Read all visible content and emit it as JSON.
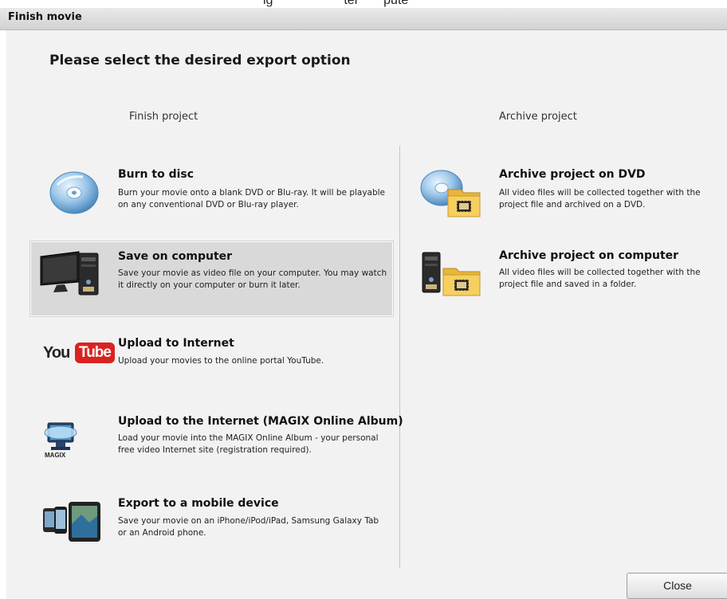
{
  "window": {
    "title": "Finish movie",
    "top_fragment": "ig                    ter       pute"
  },
  "heading": "Please select the desired export option",
  "columns": {
    "finish": "Finish project",
    "archive": "Archive project"
  },
  "finish_options": [
    {
      "title": "Burn to disc",
      "desc": "Burn your movie onto a blank DVD or Blu-ray. It will be playable on any conventional DVD or Blu-ray player.",
      "icon": "disc-icon"
    },
    {
      "title": "Save on computer",
      "desc": "Save your movie as video file on your computer. You may watch it directly on your computer or burn it later.",
      "icon": "computer-icon",
      "selected": true
    },
    {
      "title": "Upload to Internet",
      "desc": "Upload your movies to the online portal YouTube.",
      "icon": "youtube-logo"
    },
    {
      "title": "Upload to the Internet (MAGIX Online Album)",
      "desc": "Load your movie into the MAGIX Online Album - your personal free video Internet site (registration required).",
      "icon": "magix-icon"
    },
    {
      "title": "Export to a mobile device",
      "desc": "Save your movie on an iPhone/iPod/iPad, Samsung Galaxy Tab or an Android phone.",
      "icon": "mobile-devices-icon"
    }
  ],
  "archive_options": [
    {
      "title": "Archive project on DVD",
      "desc": "All video files will be collected together with the project file and archived on a DVD.",
      "icon": "dvd-folder-icon"
    },
    {
      "title": "Archive project on computer",
      "desc": "All video files will be collected together with the project file and saved in a folder.",
      "icon": "computer-folder-icon"
    }
  ],
  "youtube": {
    "you": "You",
    "tube": "Tube"
  },
  "magix_label": "MAGIX",
  "buttons": {
    "close": "Close"
  },
  "colors": {
    "selected_bg": "#d9d9d9",
    "youtube_red": "#d9231e",
    "folder_yellow": "#f2c34a"
  }
}
